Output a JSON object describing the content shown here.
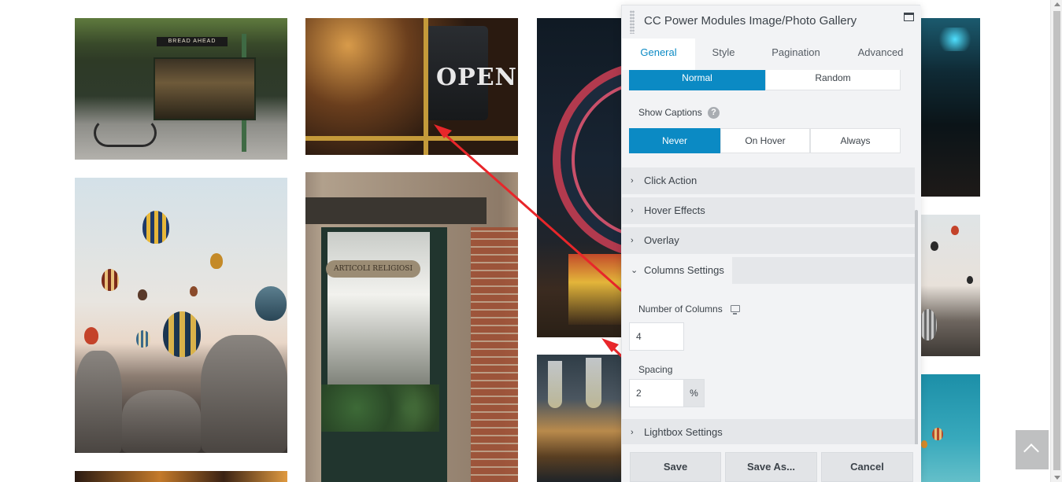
{
  "panel": {
    "title": "CC Power Modules Image/Photo Gallery",
    "tabs": [
      "General",
      "Style",
      "Pagination",
      "Advanced"
    ],
    "active_tab": "General",
    "order": {
      "options": [
        "Normal",
        "Random"
      ],
      "selected": "Normal"
    },
    "show_captions": {
      "label": "Show Captions",
      "help": "?",
      "options": [
        "Never",
        "On Hover",
        "Always"
      ],
      "selected": "Never"
    },
    "sections": {
      "click_action": "Click Action",
      "hover_effects": "Hover Effects",
      "overlay": "Overlay",
      "columns_settings": "Columns Settings",
      "lightbox_settings": "Lightbox Settings"
    },
    "columns": {
      "number_label": "Number of Columns",
      "number_value": "4",
      "spacing_label": "Spacing",
      "spacing_value": "2",
      "spacing_unit": "%"
    },
    "footer": {
      "save": "Save",
      "save_as": "Save As...",
      "cancel": "Cancel"
    }
  },
  "gallery": {
    "bakery_sign": "BREAD AHEAD",
    "open_sign": "OPEN",
    "shop_sign": "ARTICOLI RELIGIOSI"
  },
  "colors": {
    "accent": "#0b8ac4",
    "arrow": "#e8262a",
    "panel_bg": "#f2f3f5"
  }
}
